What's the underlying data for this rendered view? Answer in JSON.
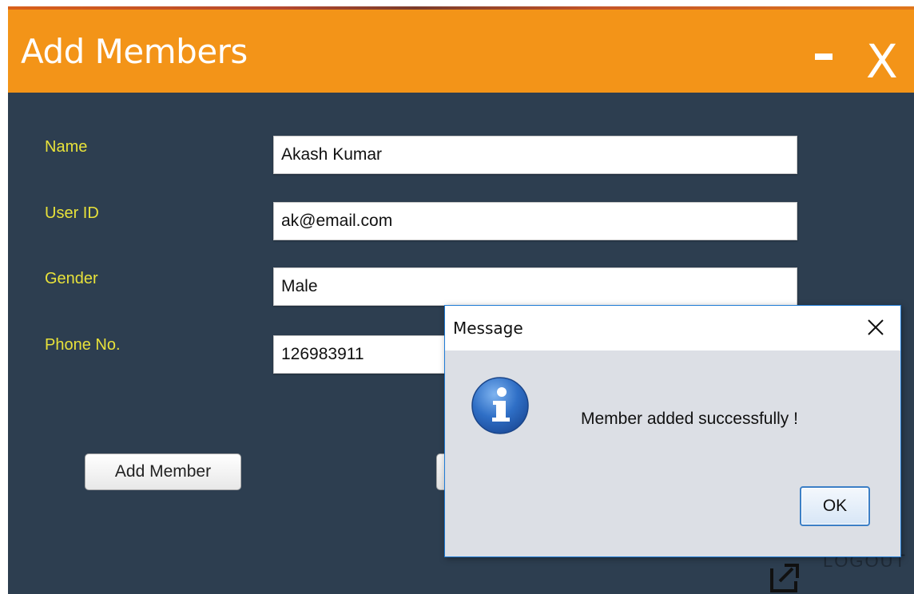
{
  "window": {
    "title": "Add Members",
    "minimize_label": "-",
    "close_label": "X"
  },
  "form": {
    "name_label": "Name",
    "name_value": "Akash Kumar",
    "userid_label": "User ID",
    "userid_value": "ak@email.com",
    "gender_label": "Gender",
    "gender_value": "Male",
    "phone_label": "Phone No.",
    "phone_value": "126983911",
    "add_member_label": "Add Member"
  },
  "logout": {
    "label": "LOGOUT"
  },
  "dialog": {
    "title": "Message",
    "message": "Member added successfully !",
    "ok_label": "OK",
    "icon": "info-icon"
  },
  "colors": {
    "title_bar": "#f39418",
    "background": "#2d3e50",
    "label": "#e8e23a",
    "dialog_border": "#1f7bd6"
  }
}
